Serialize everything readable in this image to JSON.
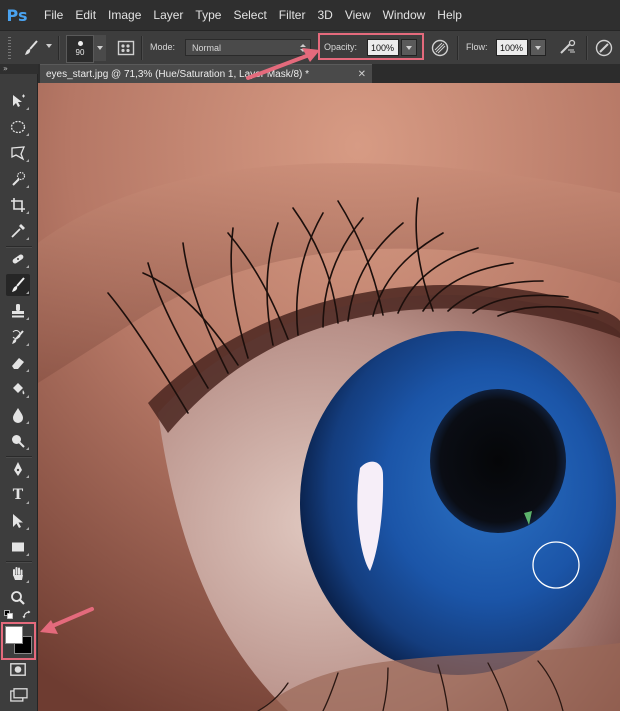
{
  "app": {
    "logo_text": "Ps"
  },
  "menu": [
    "File",
    "Edit",
    "Image",
    "Layer",
    "Type",
    "Select",
    "Filter",
    "3D",
    "View",
    "Window",
    "Help"
  ],
  "options_bar": {
    "brush_size": "90",
    "mode_label": "Mode:",
    "mode_value": "Normal",
    "opacity_label": "Opacity:",
    "opacity_value": "100%",
    "flow_label": "Flow:",
    "flow_value": "100%"
  },
  "toolbox": {
    "header": "»",
    "tools": [
      "move-tool",
      "elliptical-marquee-tool",
      "polygonal-lasso-tool",
      "quick-selection-tool",
      "crop-tool",
      "eyedropper-tool",
      "spot-healing-brush-tool",
      "brush-tool",
      "clone-stamp-tool",
      "history-brush-tool",
      "eraser-tool",
      "paint-bucket-tool",
      "blur-tool",
      "dodge-tool",
      "pen-tool",
      "type-tool",
      "path-selection-tool",
      "rectangle-tool",
      "hand-tool",
      "zoom-tool"
    ],
    "active_tool": "brush-tool",
    "type_tool_glyph": "T",
    "foreground_color": "#ffffff",
    "background_color": "#000000"
  },
  "document": {
    "tab_title": "eyes_start.jpg @ 71,3% (Hue/Saturation 1, Layer Mask/8) *",
    "close_glyph": "✕"
  },
  "colors": {
    "highlight": "#e46a7c",
    "iris_blue": "#1b55a8"
  }
}
